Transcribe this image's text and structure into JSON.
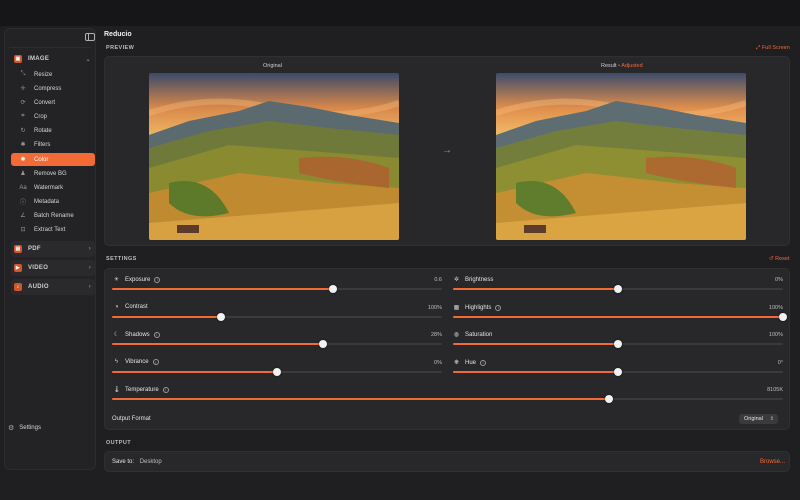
{
  "app": {
    "title": "Reducio"
  },
  "sidebar": {
    "sections": [
      {
        "label": "IMAGE",
        "icon": "image-icon"
      },
      {
        "label": "PDF",
        "icon": "pdf-icon"
      },
      {
        "label": "VIDEO",
        "icon": "video-icon"
      },
      {
        "label": "AUDIO",
        "icon": "audio-icon"
      }
    ],
    "image_items": [
      {
        "label": "Resize",
        "icon": "resize-icon",
        "glyph": "⤡"
      },
      {
        "label": "Compress",
        "icon": "compress-icon",
        "glyph": "✛"
      },
      {
        "label": "Convert",
        "icon": "convert-icon",
        "glyph": "⟳"
      },
      {
        "label": "Crop",
        "icon": "crop-icon",
        "glyph": "⌗"
      },
      {
        "label": "Rotate",
        "icon": "rotate-icon",
        "glyph": "↻"
      },
      {
        "label": "Filters",
        "icon": "filters-icon",
        "glyph": "✱"
      },
      {
        "label": "Color",
        "icon": "color-icon",
        "glyph": "✺",
        "active": true
      },
      {
        "label": "Remove BG",
        "icon": "remove-bg-icon",
        "glyph": "♟"
      },
      {
        "label": "Watermark",
        "icon": "watermark-icon",
        "glyph": "Aa"
      },
      {
        "label": "Metadata",
        "icon": "metadata-icon",
        "glyph": "ⓘ"
      },
      {
        "label": "Batch Rename",
        "icon": "batch-rename-icon",
        "glyph": "∠"
      },
      {
        "label": "Extract Text",
        "icon": "extract-text-icon",
        "glyph": "⊡"
      }
    ],
    "settings_label": "Settings"
  },
  "preview": {
    "section_label": "PREVIEW",
    "full_screen_label": "Full Screen",
    "original_label": "Original",
    "result_label": "Result",
    "adjusted_label": "• Adjusted"
  },
  "settings": {
    "section_label": "SETTINGS",
    "reset_label": "Reset",
    "sliders": [
      {
        "label": "Exposure",
        "value_text": "0.6",
        "level": 0.67,
        "icon": "exposure-icon",
        "glyph": "☀",
        "info": true
      },
      {
        "label": "Brightness",
        "value_text": "0%",
        "level": 0.5,
        "icon": "brightness-icon",
        "glyph": "✲",
        "info": false
      },
      {
        "label": "Contrast",
        "value_text": "100%",
        "level": 0.33,
        "icon": "contrast-icon",
        "glyph": "◑",
        "info": false
      },
      {
        "label": "Highlights",
        "value_text": "100%",
        "level": 1.0,
        "icon": "highlights-icon",
        "glyph": "▦",
        "info": true
      },
      {
        "label": "Shadows",
        "value_text": "28%",
        "level": 0.64,
        "icon": "shadows-icon",
        "glyph": "☾",
        "info": true
      },
      {
        "label": "Saturation",
        "value_text": "100%",
        "level": 0.5,
        "icon": "saturation-icon",
        "glyph": "◍",
        "info": false
      },
      {
        "label": "Vibrance",
        "value_text": "0%",
        "level": 0.5,
        "icon": "vibrance-icon",
        "glyph": "ϟ",
        "info": true
      },
      {
        "label": "Hue",
        "value_text": "0°",
        "level": 0.5,
        "icon": "hue-icon",
        "glyph": "❋",
        "info": true
      },
      {
        "label": "Temperature",
        "value_text": "8105K",
        "level": 0.74,
        "icon": "temperature-icon",
        "glyph": "🌡",
        "info": true
      }
    ],
    "output_format_label": "Output Format",
    "output_format_value": "Original"
  },
  "output": {
    "section_label": "OUTPUT",
    "save_to_label": "Save to:",
    "save_to_value": "Desktop",
    "browse_label": "Browse..."
  },
  "colors": {
    "accent": "#f26a35",
    "background": "#1f1f21",
    "panel": "#28282a"
  }
}
